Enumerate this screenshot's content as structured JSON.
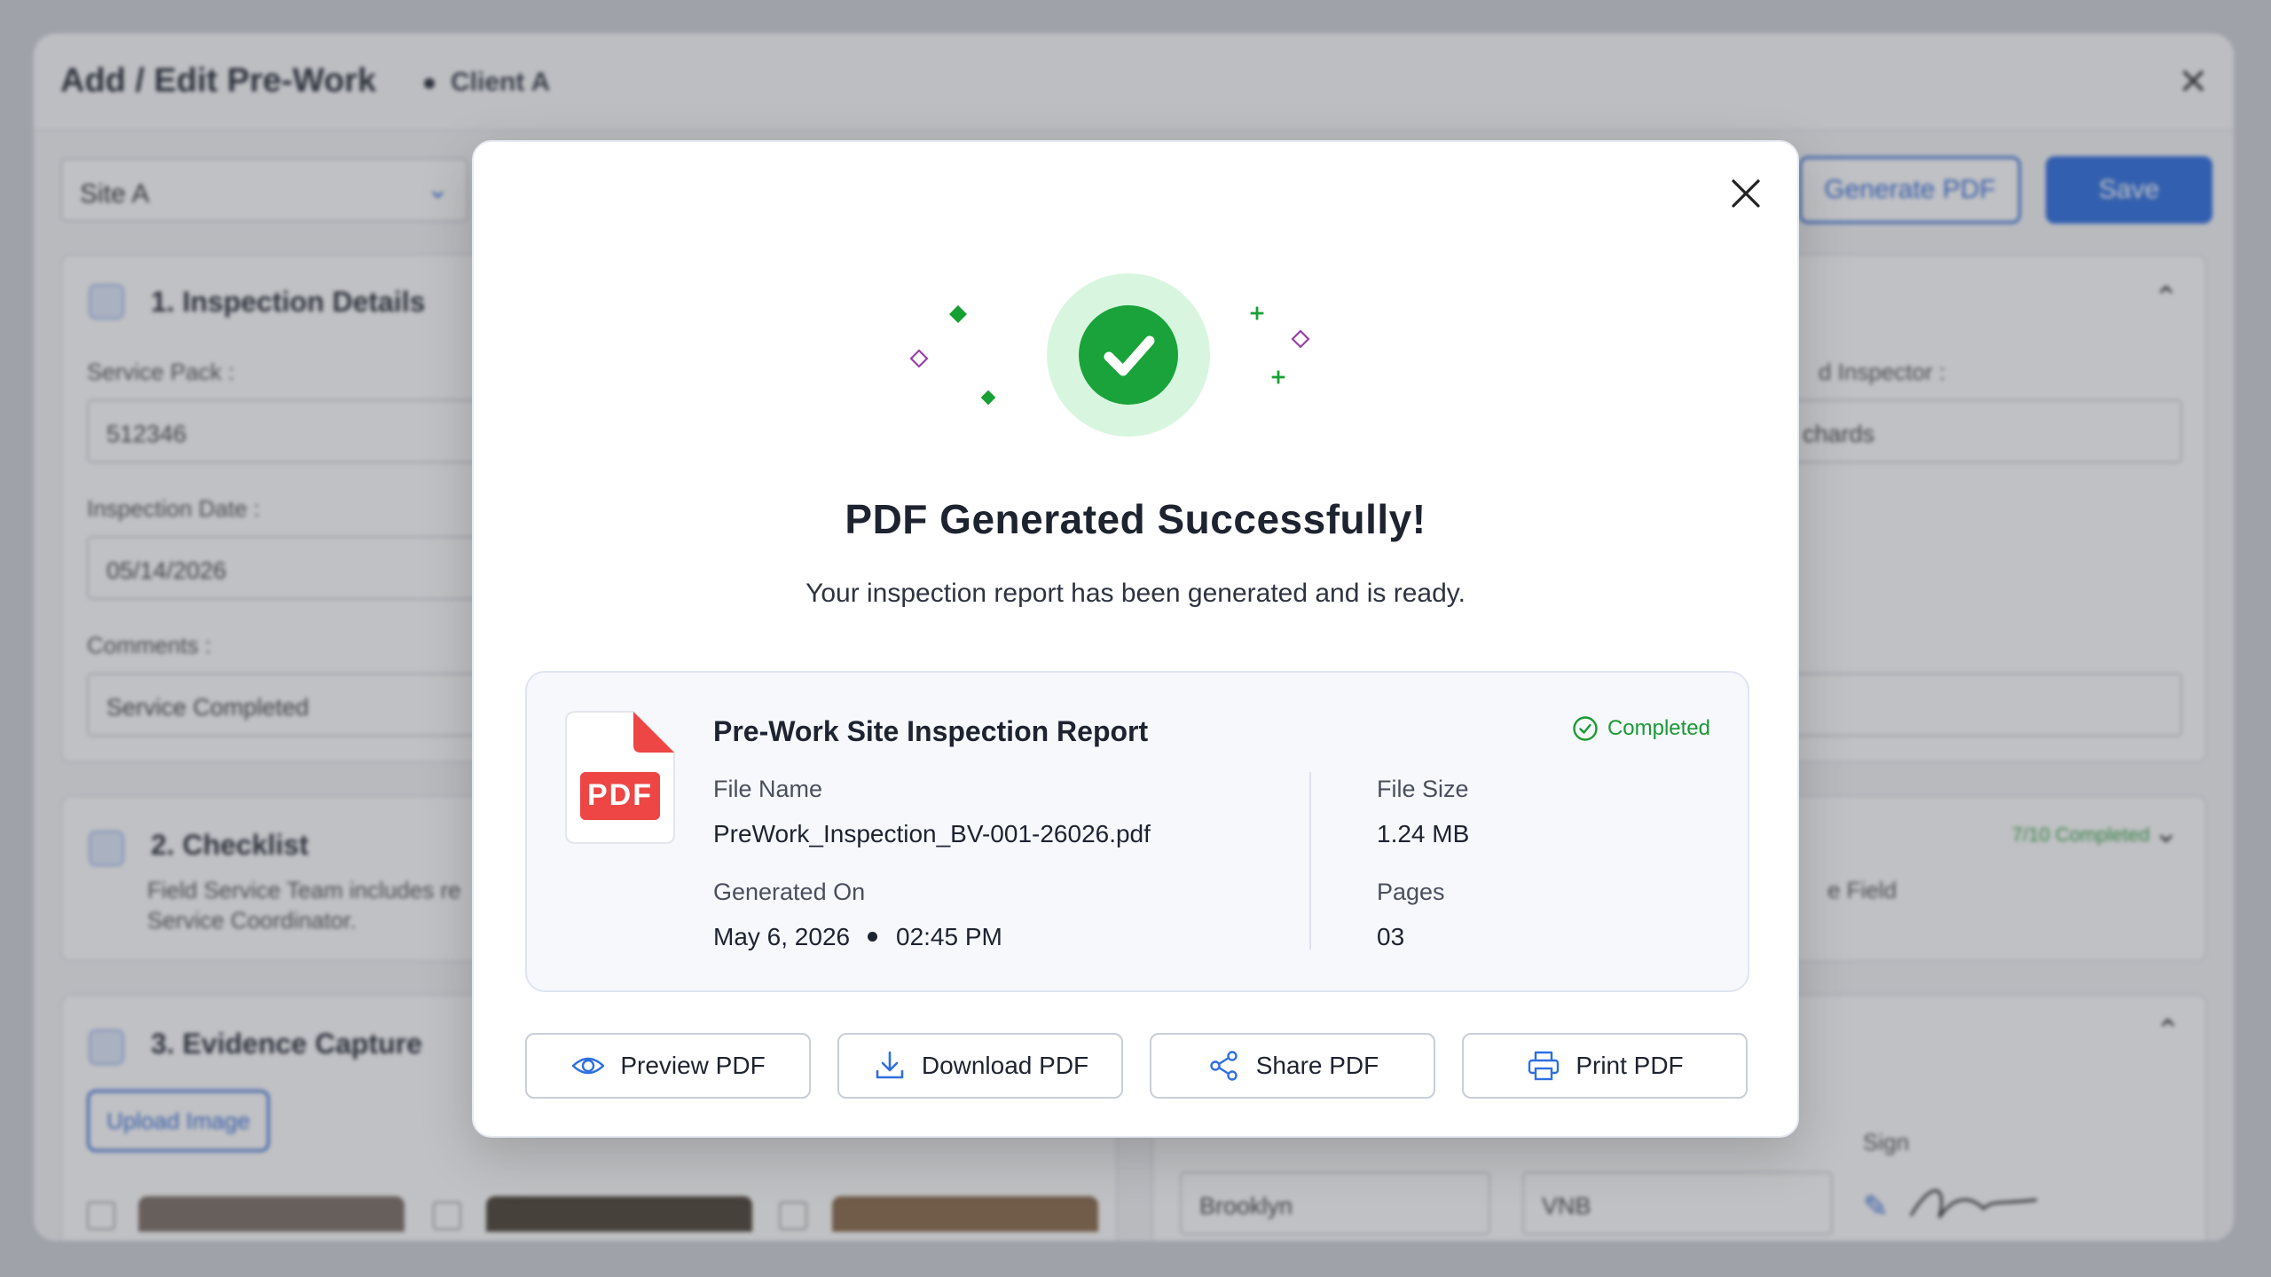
{
  "background": {
    "window_title": "Add / Edit Pre-Work",
    "client": "Client A",
    "site_select": "Site A",
    "generate_pdf_label": "Generate PDF",
    "save_label": "Save",
    "section1": {
      "title": "1. Inspection Details",
      "service_pack_label": "Service Pack :",
      "service_pack_value": "512346",
      "inspection_date_label": "Inspection Date :",
      "inspection_date_value": "05/14/2026",
      "comments_label": "Comments :",
      "comments_value": "Service Completed",
      "inspector_label": "d Inspector :",
      "inspector_value": "chards"
    },
    "section2": {
      "title": "2. Checklist",
      "text_line1": "Field Service Team includes re",
      "text_line2": "Service Coordinator.",
      "right_text": "e Field",
      "progress": "7/10 Completed"
    },
    "section3": {
      "title": "3. Evidence Capture",
      "upload_label": "Upload Image",
      "sign_label": "Sign",
      "name_value": "Brooklyn",
      "initials_value": "VNB"
    }
  },
  "modal": {
    "title": "PDF Generated Successfully!",
    "subtitle": "Your inspection report has been generated and is ready.",
    "icons": {
      "close": "close-icon",
      "success": "check-circle-icon",
      "file": "pdf-file-icon"
    },
    "file": {
      "report_title": "Pre-Work Site Inspection Report",
      "status": "Completed",
      "pdf_badge": "PDF",
      "file_name_label": "File Name",
      "file_name": "PreWork_Inspection_BV-001-26026.pdf",
      "generated_on_label": "Generated On",
      "generated_date": "May 6, 2026",
      "generated_time": "02:45 PM",
      "file_size_label": "File Size",
      "file_size": "1.24 MB",
      "pages_label": "Pages",
      "pages": "03"
    },
    "actions": {
      "preview": "Preview PDF",
      "download": "Download PDF",
      "share": "Share PDF",
      "print": "Print PDF"
    }
  },
  "colors": {
    "success_green": "#19a33a",
    "success_halo": "#d8f6df",
    "accent_blue": "#2f6fe0",
    "pdf_red": "#ee4545",
    "sparkle_purple": "#9a3fa8"
  }
}
